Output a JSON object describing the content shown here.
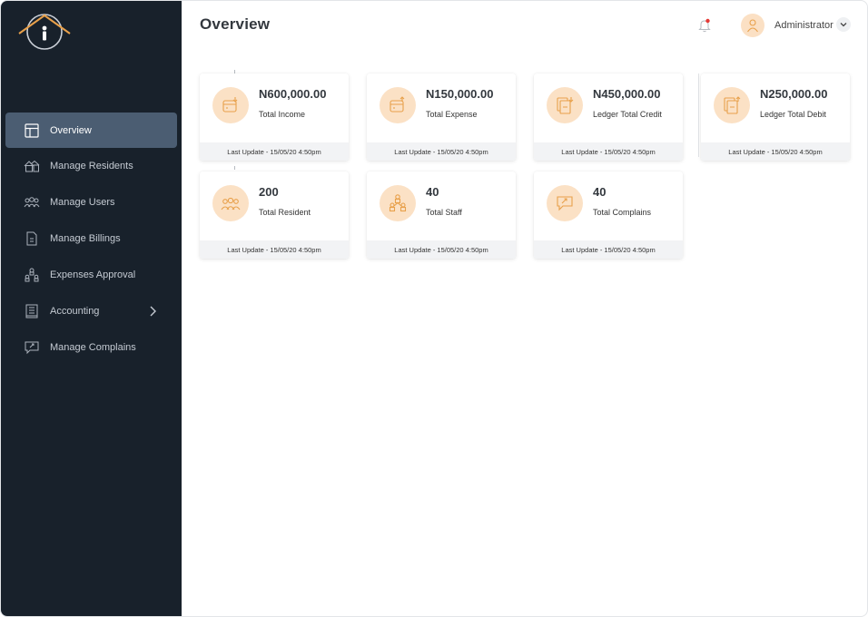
{
  "page": {
    "title": "Overview"
  },
  "header": {
    "user_name": "Administrator"
  },
  "sidebar": {
    "items": [
      {
        "label": "Overview",
        "icon": "dashboard-icon",
        "active": true
      },
      {
        "label": "Manage Residents",
        "icon": "residents-icon"
      },
      {
        "label": "Manage Users",
        "icon": "users-icon"
      },
      {
        "label": "Manage Billings",
        "icon": "billing-icon"
      },
      {
        "label": "Expenses Approval",
        "icon": "approval-icon"
      },
      {
        "label": "Accounting",
        "icon": "accounting-icon",
        "has_submenu": true
      },
      {
        "label": "Manage Complains",
        "icon": "complains-icon"
      }
    ]
  },
  "cards": [
    {
      "value": "N600,000.00",
      "label": "Total Income",
      "footer": "Last Update - 15/05/20 4:50pm",
      "icon": "wallet-in-icon"
    },
    {
      "value": "N150,000.00",
      "label": "Total Expense",
      "footer": "Last Update - 15/05/20 4:50pm",
      "icon": "wallet-out-icon"
    },
    {
      "value": "N450,000.00",
      "label": "Ledger Total Credit",
      "footer": "Last Update - 15/05/20 4:50pm",
      "icon": "ledger-credit-icon"
    },
    {
      "value": "N250,000.00",
      "label": "Ledger Total Debit",
      "footer": "Last Update - 15/05/20 4:50pm",
      "icon": "ledger-debit-icon"
    },
    {
      "value": "200",
      "label": "Total Resident",
      "footer": "Last Update - 15/05/20 4:50pm",
      "icon": "residents-group-icon"
    },
    {
      "value": "40",
      "label": "Total Staff",
      "footer": "Last Update - 15/05/20 4:50pm",
      "icon": "staff-icon"
    },
    {
      "value": "40",
      "label": "Total Complains",
      "footer": "Last Update - 15/05/20 4:50pm",
      "icon": "complain-icon"
    }
  ],
  "colors": {
    "sidebar": "#18212b",
    "active": "#4b5d72",
    "accent": "#e8a04a",
    "icon_bg": "#fbe1c5",
    "notification": "#e53935"
  }
}
